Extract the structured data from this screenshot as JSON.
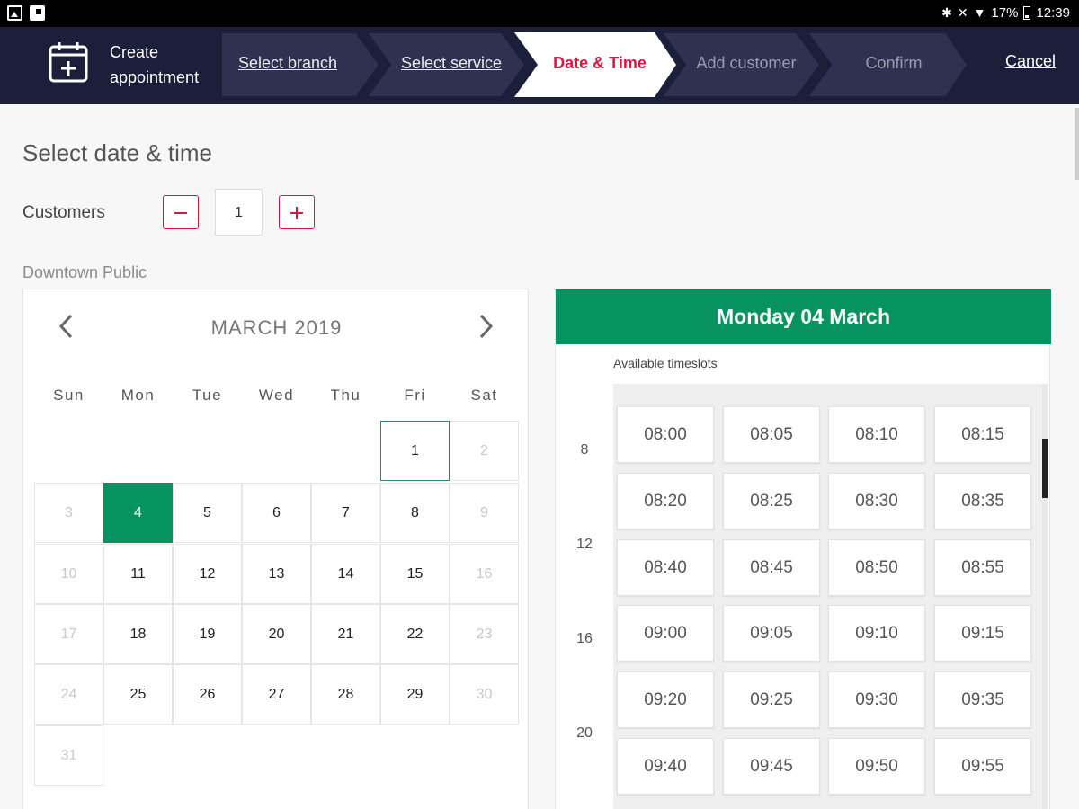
{
  "status_bar": {
    "battery": "17%",
    "time": "12:39",
    "left_icons": [
      "gallery-icon",
      "flipboard-icon"
    ],
    "right_icons": [
      "bluetooth-icon",
      "mute-icon",
      "wifi-icon",
      "battery-icon"
    ]
  },
  "header": {
    "title": "Create appointment",
    "title_line1": "Create",
    "title_line2": "appointment",
    "steps": [
      {
        "label": "Select branch",
        "state": "link"
      },
      {
        "label": "Select service",
        "state": "link"
      },
      {
        "label": "Date & Time",
        "state": "active"
      },
      {
        "label": "Add customer",
        "state": "inactive"
      },
      {
        "label": "Confirm",
        "state": "inactive"
      }
    ],
    "cancel_label": "Cancel",
    "colors": {
      "background": "#1b1f3a",
      "step": "#2e3250",
      "active_step": "#ffffff",
      "active_text": "#d8163f"
    }
  },
  "main": {
    "title": "Select date & time",
    "customers_label": "Customers",
    "customers_value": "1",
    "branch": "Downtown Public"
  },
  "calendar": {
    "month_label": "MARCH 2019",
    "weekdays": [
      "Sun",
      "Mon",
      "Tue",
      "Wed",
      "Thu",
      "Fri",
      "Sat"
    ],
    "first_weekday_index": 5,
    "days_in_month": 31,
    "selected_day": 4,
    "outlined_day": 1,
    "muted_days": [
      2,
      3,
      9,
      10,
      16,
      17,
      23,
      24,
      30,
      31
    ],
    "accent": "#079361"
  },
  "timeslots": {
    "header": "Monday 04 March",
    "caption": "Available timeslots",
    "hour_labels": [
      "8",
      "12",
      "16",
      "20"
    ],
    "slots": [
      "08:00",
      "08:05",
      "08:10",
      "08:15",
      "08:20",
      "08:25",
      "08:30",
      "08:35",
      "08:40",
      "08:45",
      "08:50",
      "08:55",
      "09:00",
      "09:05",
      "09:10",
      "09:15",
      "09:20",
      "09:25",
      "09:30",
      "09:35",
      "09:40",
      "09:45",
      "09:50",
      "09:55"
    ]
  }
}
